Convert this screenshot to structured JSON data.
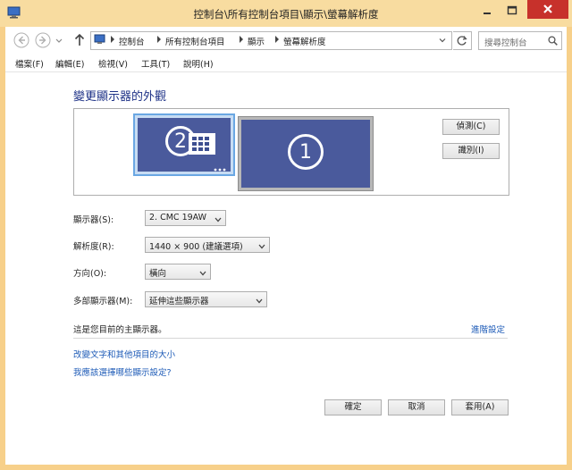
{
  "window": {
    "title": "控制台\\所有控制台項目\\顯示\\螢幕解析度"
  },
  "nav": {
    "breadcrumbs": [
      "控制台",
      "所有控制台項目",
      "顯示",
      "螢幕解析度"
    ],
    "search_placeholder": "搜尋控制台"
  },
  "menu": {
    "items": [
      "檔案(F)",
      "編輯(E)",
      "檢視(V)",
      "工具(T)",
      "說明(H)"
    ]
  },
  "main": {
    "heading": "變更顯示器的外觀",
    "monitors": [
      {
        "number": "2",
        "selected": true
      },
      {
        "number": "1",
        "selected": false
      }
    ],
    "detect_label": "偵測(C)",
    "identify_label": "識別(I)",
    "display_label": "顯示器(S):",
    "display_value": "2. CMC 19AW",
    "resolution_label": "解析度(R):",
    "resolution_value": "1440 × 900 (建議選項)",
    "orientation_label": "方向(O):",
    "orientation_value": "橫向",
    "multi_label": "多部顯示器(M):",
    "multi_value": "延伸這些顯示器",
    "primary_text": "這是您目前的主顯示器。",
    "advanced_link": "進階設定",
    "link_text_size": "改變文字和其他項目的大小",
    "link_which_settings": "我應該選擇哪些顯示設定?"
  },
  "footer": {
    "ok_label": "確定",
    "cancel_label": "取消",
    "apply_label": "套用(A)"
  },
  "colors": {
    "accent_link": "#1e5bb7",
    "heading": "#1e3287",
    "monitor_screen": "#4a5a9c",
    "selection": "#6aa7e3",
    "close_button": "#c7312b",
    "title_bar": "#f8dca0"
  }
}
